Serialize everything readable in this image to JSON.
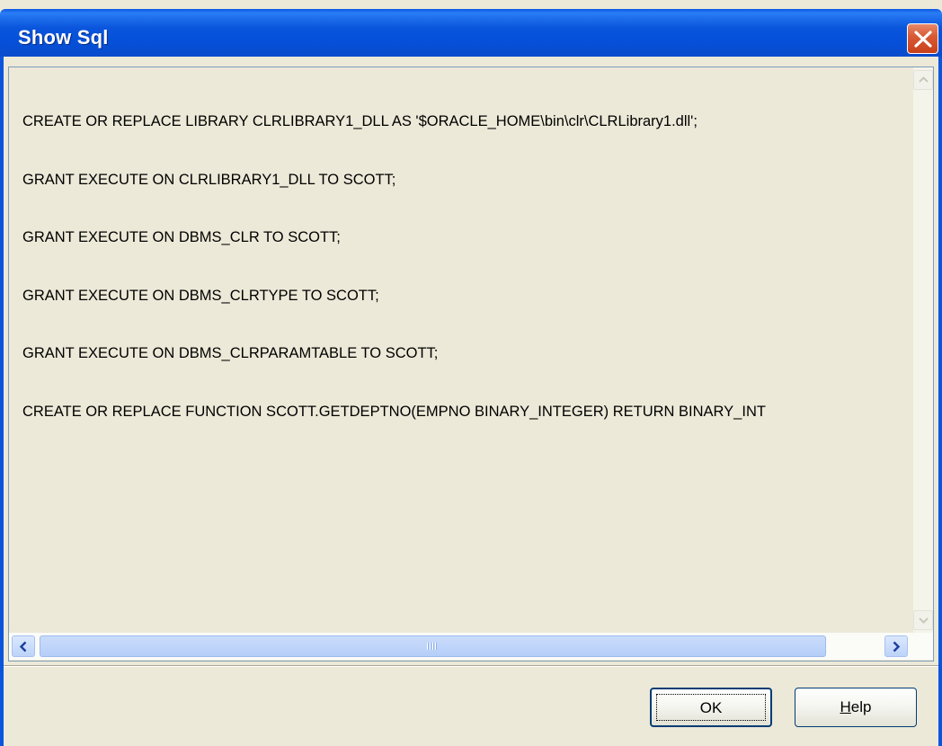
{
  "window": {
    "title": "Show Sql"
  },
  "sql": {
    "lines": [
      "CREATE OR REPLACE LIBRARY CLRLIBRARY1_DLL AS '$ORACLE_HOME\\bin\\clr\\CLRLibrary1.dll';",
      "GRANT EXECUTE ON CLRLIBRARY1_DLL TO SCOTT;",
      "GRANT EXECUTE ON DBMS_CLR TO SCOTT;",
      "GRANT EXECUTE ON DBMS_CLRTYPE TO SCOTT;",
      "GRANT EXECUTE ON DBMS_CLRPARAMTABLE TO SCOTT;",
      "CREATE OR REPLACE FUNCTION SCOTT.GETDEPTNO(EMPNO BINARY_INTEGER) RETURN BINARY_INT"
    ]
  },
  "buttons": {
    "ok_label": "OK",
    "help_label_first": "H",
    "help_label_rest": "elp"
  },
  "icons": {
    "close": "close-icon",
    "scroll_up": "chevron-up-icon",
    "scroll_down": "chevron-down-icon",
    "scroll_left": "chevron-left-icon",
    "scroll_right": "chevron-right-icon"
  },
  "colors": {
    "titlebar": "#0a55dc",
    "close_button": "#d95b35",
    "dialog_background": "#ece9d8",
    "scroll_thumb": "#b5cef8"
  }
}
